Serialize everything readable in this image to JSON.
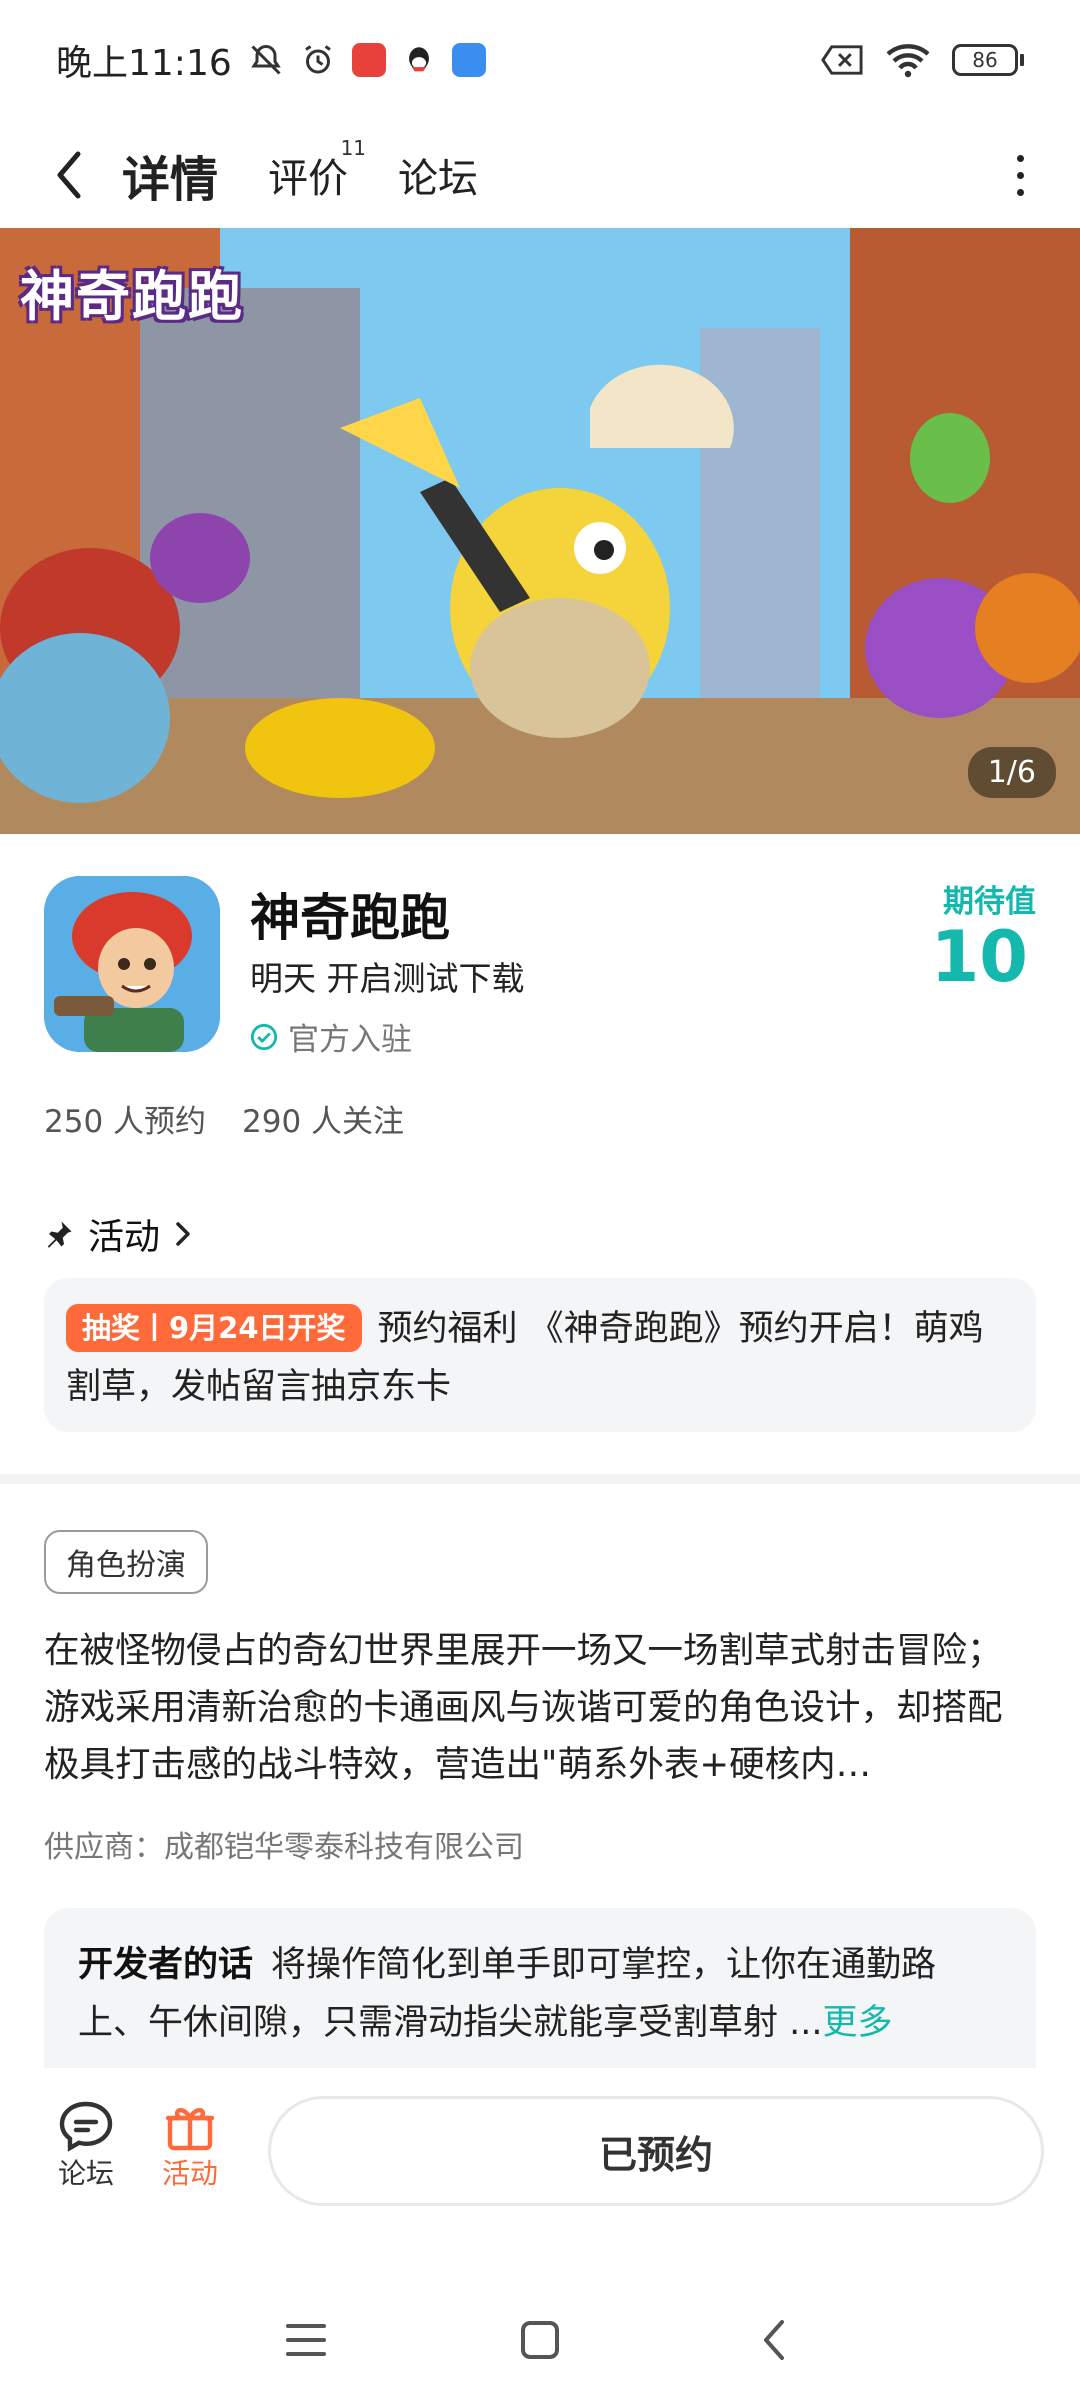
{
  "status_bar": {
    "time": "晚上11:16",
    "battery": "86"
  },
  "nav": {
    "tabs": [
      {
        "label": "详情",
        "badge": ""
      },
      {
        "label": "评价",
        "badge": "11"
      },
      {
        "label": "论坛",
        "badge": ""
      }
    ],
    "accent": "#14c9bd"
  },
  "banner": {
    "logo_text": "神奇跑跑",
    "counter": "1/6"
  },
  "app": {
    "name": "神奇跑跑",
    "release": "明天 开启测试下载",
    "official": "官方入驻",
    "expect_label": "期待值",
    "expect_value": "10"
  },
  "stats": {
    "reservations": "250 人预约",
    "followers": "290 人关注"
  },
  "activity": {
    "header": "活动",
    "tag": "抽奖丨9月24日开奖",
    "text": "预约福利 《神奇跑跑》预约开启！萌鸡割草，发帖留言抽京东卡"
  },
  "details": {
    "genre": "角色扮演",
    "description": "在被怪物侵占的奇幻世界里展开一场又一场割草式射击冒险；游戏采用清新治愈的卡通画风与诙谐可爱的角色设计，却搭配极具打击感的战斗特效，营造出\"萌系外表+硬核内…",
    "supplier": "供应商：成都铠华零泰科技有限公司"
  },
  "developer": {
    "label": "开发者的话",
    "text": "将操作简化到单手即可掌控，让你在通勤路上、午休间隙，只需滑动指尖就能享受割草射 ...",
    "more": "更多"
  },
  "bottom_bar": {
    "forum": "论坛",
    "activity": "活动",
    "reserve": "已预约"
  },
  "colors": {
    "accent": "#14b8ad",
    "orange": "#ff6a3a"
  }
}
